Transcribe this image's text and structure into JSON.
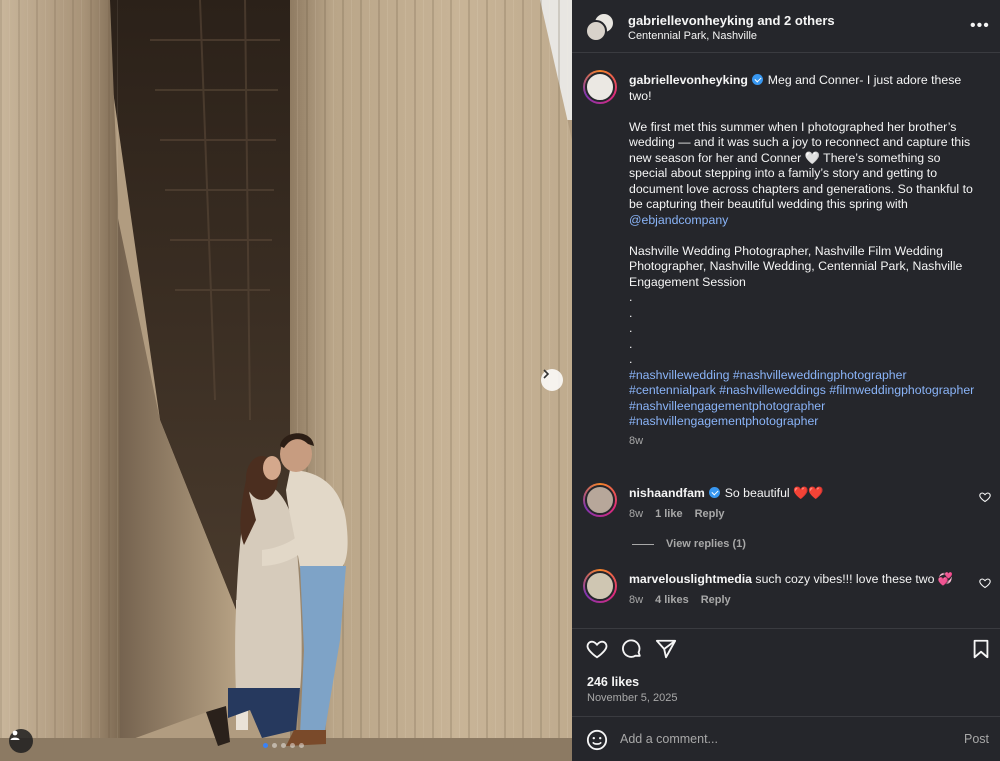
{
  "header": {
    "username": "gabriellevonheyking",
    "and_others": " and 2 others",
    "location": "Centennial Park, Nashville",
    "more_icon": "more-horizontal-icon"
  },
  "caption": {
    "username": "gabriellevonheyking",
    "first_line": " Meg and Conner- I just adore these two!",
    "paragraph1": "We first met this summer when I photographed her brother’s wedding — and it was such a joy to reconnect and capture this new season for her and Conner 🤍 There’s something so special about stepping into a family’s story and getting to document love across chapters and generations. So thankful to be capturing their beautiful wedding this spring with",
    "mention": "@ebjandcompany",
    "paragraph2": "Nashville Wedding Photographer, Nashville Film Wedding Photographer, Nashville Wedding, Centennial Park, Nashville Engagement Session",
    "dots": [
      ".",
      ".",
      ".",
      ".",
      "."
    ],
    "hashtags": [
      "#nashvillewedding",
      "#nashvilleweddingphotographer",
      "#centennialpark",
      "#nashvilleweddings",
      "#filmweddingphotographer",
      "#nashvilleengagementphotographer",
      "#nashvillengagementphotographer"
    ],
    "time": "8w"
  },
  "comments": [
    {
      "username": "nishaandfam",
      "verified": true,
      "text": " So beautiful ❤️❤️",
      "time": "8w",
      "likes": "1 like",
      "reply": "Reply"
    },
    {
      "username": "marvelouslightmedia",
      "verified": false,
      "text": " such cozy vibes!!! love these two 💞",
      "time": "8w",
      "likes": "4 likes",
      "reply": "Reply"
    }
  ],
  "view_replies": "View replies (1)",
  "actions": {
    "like_icon": "heart-icon",
    "comment_icon": "comment-icon",
    "share_icon": "share-icon",
    "save_icon": "bookmark-icon"
  },
  "likes": "246 likes",
  "date": "November 5, 2025",
  "add_comment": {
    "placeholder": "Add a comment...",
    "post_label": "Post"
  },
  "carousel": {
    "total_slides": 5,
    "active_slide": 1
  },
  "colors": {
    "panel_bg": "#25262b",
    "link": "#8ab4f8",
    "verified": "#3897f0",
    "muted": "#a8a8a8"
  }
}
